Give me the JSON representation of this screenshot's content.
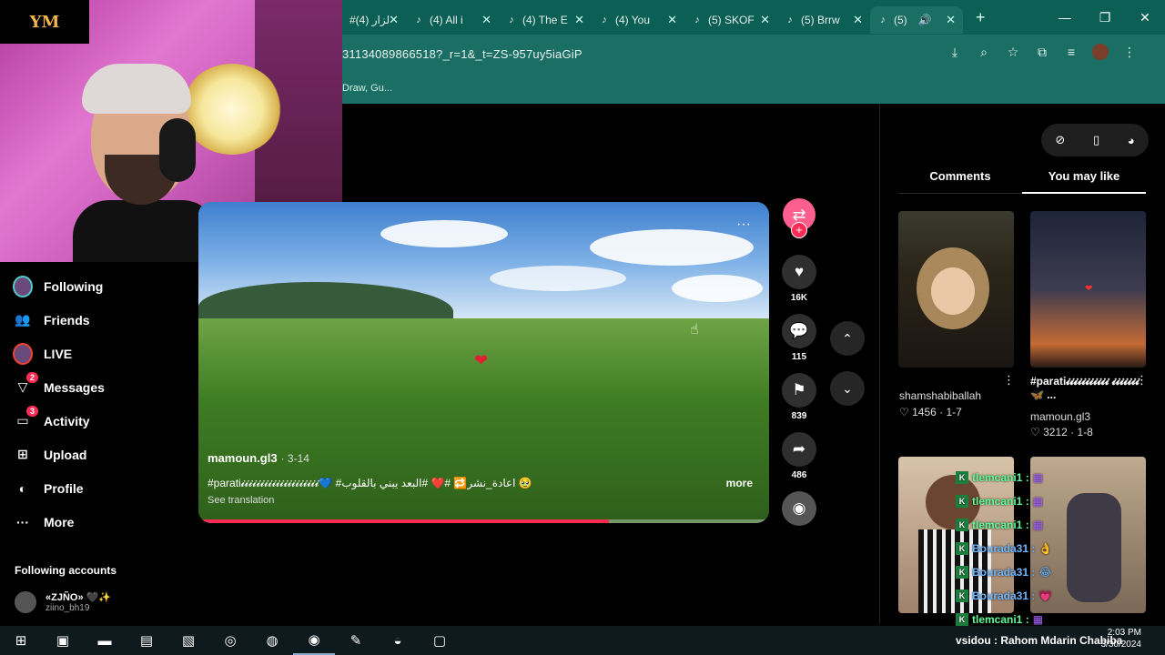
{
  "browser": {
    "tabs": [
      {
        "label": "#(4) لزار"
      },
      {
        "label": "(4) All i"
      },
      {
        "label": "(4) The E"
      },
      {
        "label": "(4) You"
      },
      {
        "label": "(5) SKOF"
      },
      {
        "label": "(5) Brrw"
      },
      {
        "label": "(5)"
      }
    ],
    "url": "31134089866518?_r=1&_t=ZS-957uy5iaGiP",
    "bookmarks": "Draw, Gu..."
  },
  "webcam": {
    "logo": "YM"
  },
  "nav": {
    "items": [
      {
        "label": "Following",
        "icon": "following-avatar-icon"
      },
      {
        "label": "Friends",
        "icon": "friends-icon"
      },
      {
        "label": "LIVE",
        "icon": "live-icon"
      },
      {
        "label": "Messages",
        "icon": "messages-icon",
        "badge": "2"
      },
      {
        "label": "Activity",
        "icon": "activity-icon",
        "badge": "3"
      },
      {
        "label": "Upload",
        "icon": "upload-icon"
      },
      {
        "label": "Profile",
        "icon": "profile-icon"
      },
      {
        "label": "More",
        "icon": "more-icon"
      }
    ],
    "following_title": "Following accounts",
    "following_account": {
      "name": "«ZJÑO» 🖤✨",
      "handle": "ziino_bh19"
    }
  },
  "video": {
    "author": "mamoun.gl3",
    "date": "· 3-14",
    "caption": "#parati𝓲𝓲𝓲𝓲𝓲𝓲𝓲𝓲𝓲𝓲𝓲𝓲𝓲𝓲𝓲𝓲𝓲𝓲𝓲𝓲💙 #اعادة_نشر🔁 #❤️ #البعد يبني بالقلوب 🥹",
    "more": "more",
    "see_translation": "See translation",
    "progress": 0.72
  },
  "actions": {
    "likes": "16K",
    "comments": "115",
    "saves": "839",
    "shares": "486"
  },
  "right_panel": {
    "tabs": [
      "Comments",
      "You may like"
    ],
    "active_tab": 1,
    "cards": [
      {
        "title": "",
        "author": "shamshabiballah",
        "likes": "1456",
        "date": "1-7"
      },
      {
        "title": "#parati𝓲𝓲𝓲𝓲𝓲𝓲𝓲𝓲𝓲𝓲𝓲 𝓲𝓲𝓲𝓲𝓲𝓲𝓲🦋 ...",
        "author": "mamoun.gl3",
        "likes": "3212",
        "date": "1-8"
      }
    ]
  },
  "chat": {
    "lines": [
      {
        "user": "tlemcani1 :",
        "msg": "▦"
      },
      {
        "user": "tlemcani1 :",
        "msg": "▦"
      },
      {
        "user": "tlemcani1 :",
        "msg": "▦"
      },
      {
        "user": "Bourada31 :",
        "msg": "👌"
      },
      {
        "user": "Bourada31 :",
        "msg": "😂"
      },
      {
        "user": "Bourada31 :",
        "msg": "💗"
      },
      {
        "user": "tlemcani1 :",
        "msg": "▦"
      }
    ],
    "ticker": "vsidou : Rahom Mdarin Chabiba"
  },
  "taskbar": {
    "time": "2:03 PM",
    "date": "3/30/2024"
  }
}
